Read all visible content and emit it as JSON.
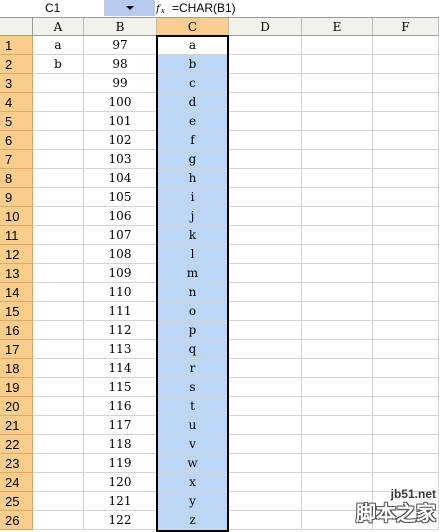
{
  "formula_bar": {
    "name_box": "C1",
    "fx_icon": "fx-icon",
    "formula": "=CHAR(B1)"
  },
  "columns": [
    "A",
    "B",
    "C",
    "D",
    "E",
    "F"
  ],
  "selected_column": "C",
  "rows": [
    {
      "num": "1",
      "a": "a",
      "b": "97",
      "c": "a"
    },
    {
      "num": "2",
      "a": "b",
      "b": "98",
      "c": "b"
    },
    {
      "num": "3",
      "a": "",
      "b": "99",
      "c": "c"
    },
    {
      "num": "4",
      "a": "",
      "b": "100",
      "c": "d"
    },
    {
      "num": "5",
      "a": "",
      "b": "101",
      "c": "e"
    },
    {
      "num": "6",
      "a": "",
      "b": "102",
      "c": "f"
    },
    {
      "num": "7",
      "a": "",
      "b": "103",
      "c": "g"
    },
    {
      "num": "8",
      "a": "",
      "b": "104",
      "c": "h"
    },
    {
      "num": "9",
      "a": "",
      "b": "105",
      "c": "i"
    },
    {
      "num": "10",
      "a": "",
      "b": "106",
      "c": "j"
    },
    {
      "num": "11",
      "a": "",
      "b": "107",
      "c": "k"
    },
    {
      "num": "12",
      "a": "",
      "b": "108",
      "c": "l"
    },
    {
      "num": "13",
      "a": "",
      "b": "109",
      "c": "m"
    },
    {
      "num": "14",
      "a": "",
      "b": "110",
      "c": "n"
    },
    {
      "num": "15",
      "a": "",
      "b": "111",
      "c": "o"
    },
    {
      "num": "16",
      "a": "",
      "b": "112",
      "c": "p"
    },
    {
      "num": "17",
      "a": "",
      "b": "113",
      "c": "q"
    },
    {
      "num": "18",
      "a": "",
      "b": "114",
      "c": "r"
    },
    {
      "num": "19",
      "a": "",
      "b": "115",
      "c": "s"
    },
    {
      "num": "20",
      "a": "",
      "b": "116",
      "c": "t"
    },
    {
      "num": "21",
      "a": "",
      "b": "117",
      "c": "u"
    },
    {
      "num": "22",
      "a": "",
      "b": "118",
      "c": "v"
    },
    {
      "num": "23",
      "a": "",
      "b": "119",
      "c": "w"
    },
    {
      "num": "24",
      "a": "",
      "b": "120",
      "c": "x"
    },
    {
      "num": "25",
      "a": "",
      "b": "121",
      "c": "y"
    },
    {
      "num": "26",
      "a": "",
      "b": "122",
      "c": "z"
    }
  ],
  "watermark": {
    "top": "jb51.net",
    "bottom": "脚本之家"
  },
  "colors": {
    "selection_fill": "#bcd7f5",
    "header_selected": "#f9ce8b",
    "header_bg": "#f3f2ea"
  }
}
